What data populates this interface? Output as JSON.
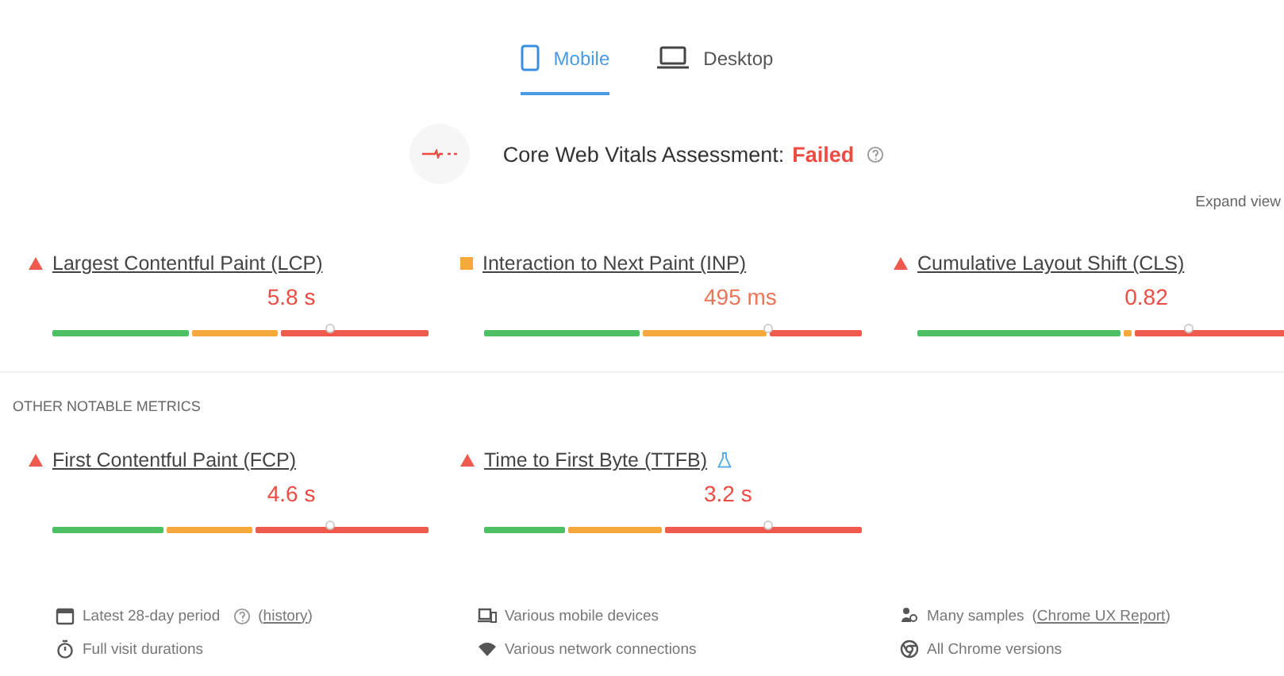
{
  "tabs": [
    {
      "label": "Mobile",
      "selected": true
    },
    {
      "label": "Desktop",
      "selected": false
    }
  ],
  "assessment": {
    "label": "Core Web Vitals Assessment:",
    "result": "Failed"
  },
  "expand_link": "Expand view",
  "core_metrics": [
    {
      "name": "Largest Contentful Paint (LCP)",
      "kind": "poor",
      "value": "5.8 s",
      "level": 0.74
    },
    {
      "name": "Interaction to Next Paint (INP)",
      "kind": "needs_improvement",
      "value": "495 ms",
      "level": 0.75
    },
    {
      "name": "Cumulative Layout Shift (CLS)",
      "kind": "poor",
      "value": "0.82",
      "level": 0.72
    }
  ],
  "other_heading": "OTHER NOTABLE METRICS",
  "other_metrics": [
    {
      "name": "First Contentful Paint (FCP)",
      "kind": "poor",
      "value": "4.6 s",
      "level": 0.74
    },
    {
      "name": "Time to First Byte (TTFB)",
      "kind": "poor",
      "value": "3.2 s",
      "level": 0.75,
      "experimental": true
    }
  ],
  "footer": [
    {
      "text": "Latest 28-day period",
      "info": true,
      "link": "history",
      "link_prefix": "(",
      "link_suffix": ")"
    },
    {
      "text": "Various mobile devices"
    },
    {
      "text": "Many samples",
      "link": "Chrome UX Report",
      "link_prefix": "(",
      "link_suffix": ")"
    },
    {
      "text": "Full visit durations"
    },
    {
      "text": "Various network connections"
    },
    {
      "text": "All Chrome versions"
    }
  ]
}
